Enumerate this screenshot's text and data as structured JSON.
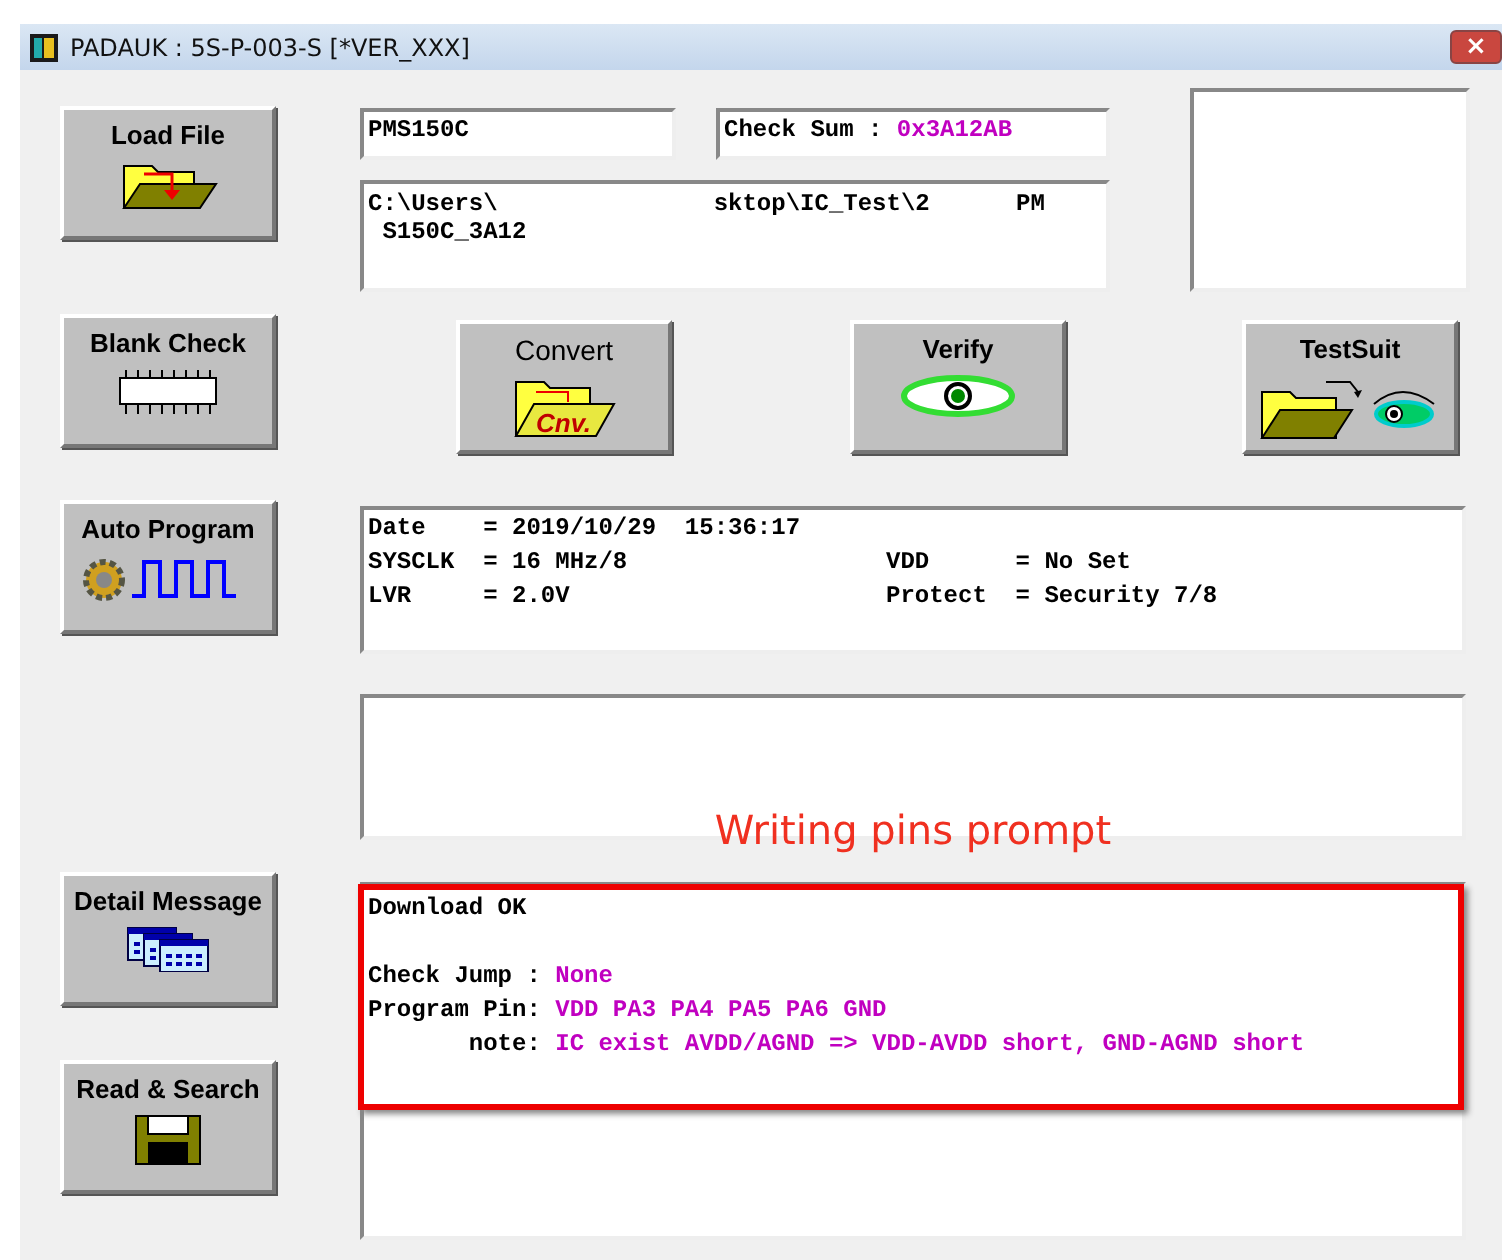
{
  "window": {
    "title": "PADAUK : 5S-P-003-S [*VER_XXX]",
    "close": "×"
  },
  "side_buttons": [
    {
      "label": "Load File",
      "kind": "folder"
    },
    {
      "label": "Blank Check",
      "kind": "chip"
    },
    {
      "label": "Auto Program",
      "kind": "gear-wave"
    },
    {
      "label": "Detail Message",
      "kind": "windows"
    },
    {
      "label": "Read & Search",
      "kind": "floppy"
    }
  ],
  "ic_field": {
    "value": "PMS150C"
  },
  "check_sum": {
    "label": "Check Sum : ",
    "value": "0x3A12AB"
  },
  "path_box": {
    "lines": [
      "C:\\Users\\               sktop\\IC_Test\\2      PM",
      " S150C_3A12"
    ]
  },
  "action_buttons": [
    {
      "label": "Convert",
      "kind": "convert",
      "icon_text": "Cnv."
    },
    {
      "label": "Verify",
      "kind": "eye"
    },
    {
      "label": "TestSuit",
      "kind": "folder-eye"
    }
  ],
  "info": {
    "rows": [
      [
        {
          "key": "Date",
          "sign": "=",
          "value": "2019/10/29  15:36:17"
        }
      ],
      [
        {
          "key": "SYSCLK",
          "sign": "=",
          "value": "16 MHz/8"
        },
        {
          "key": "VDD",
          "sign": "=",
          "value": "No Set"
        }
      ],
      [
        {
          "key": "LVR",
          "sign": "=",
          "value": "2.0V"
        },
        {
          "key": "Protect",
          "sign": "=",
          "value": "Security 7/8"
        }
      ]
    ]
  },
  "annotation": {
    "text": "Writing pins prompt"
  },
  "message": {
    "lines": [
      {
        "kind": "text",
        "label": "Download OK"
      },
      {
        "kind": "blank"
      },
      {
        "kind": "text",
        "label": "Check Jump : ",
        "value": "None"
      },
      {
        "kind": "text",
        "label": "Program Pin: ",
        "value": "VDD PA3 PA4 PA5 PA6 GND"
      },
      {
        "kind": "text",
        "label": "       note: ",
        "value": "IC exist AVDD/AGND => VDD-AVDD short, GND-AGND short"
      }
    ]
  }
}
